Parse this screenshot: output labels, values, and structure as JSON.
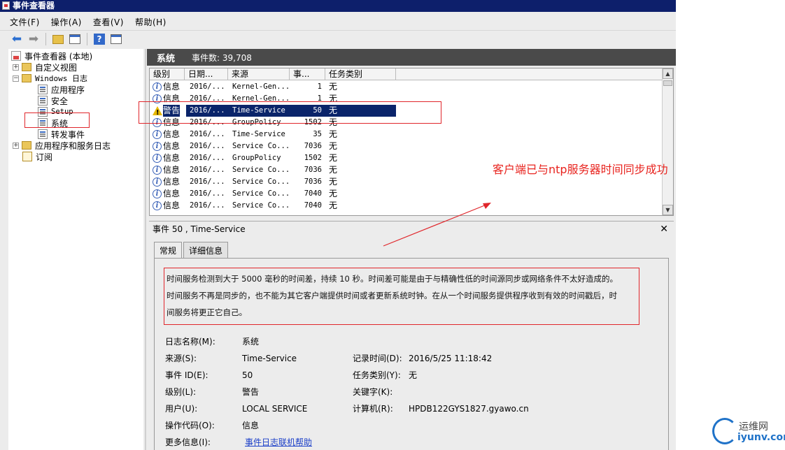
{
  "window": {
    "title": "事件查看器"
  },
  "menu": [
    "文件(F)",
    "操作(A)",
    "查看(V)",
    "帮助(H)"
  ],
  "tree": {
    "root": "事件查看器 (本地)",
    "custom_views": "自定义视图",
    "windows_logs": "Windows 日志",
    "app": "应用程序",
    "security": "安全",
    "setup": "Setup",
    "system": "系统",
    "forwarded": "转发事件",
    "app_service_logs": "应用程序和服务日志",
    "subscriptions": "订阅"
  },
  "panel": {
    "title": "系统",
    "count": "事件数: 39,708"
  },
  "grid": {
    "columns": [
      "级别",
      "日期...",
      "来源",
      "事...",
      "任务类别"
    ],
    "rows": [
      {
        "level": "信息",
        "type": "info",
        "date": "2016/...",
        "source": "Kernel-Gen...",
        "id": "1",
        "cat": "无"
      },
      {
        "level": "信息",
        "type": "info",
        "date": "2016/...",
        "source": "Kernel-Gen...",
        "id": "1",
        "cat": "无"
      },
      {
        "level": "警告",
        "type": "warn",
        "date": "2016/...",
        "source": "Time-Service",
        "id": "50",
        "cat": "无"
      },
      {
        "level": "信息",
        "type": "info",
        "date": "2016/...",
        "source": "GroupPolicy",
        "id": "1502",
        "cat": "无"
      },
      {
        "level": "信息",
        "type": "info",
        "date": "2016/...",
        "source": "Time-Service",
        "id": "35",
        "cat": "无"
      },
      {
        "level": "信息",
        "type": "info",
        "date": "2016/...",
        "source": "Service Co...",
        "id": "7036",
        "cat": "无"
      },
      {
        "level": "信息",
        "type": "info",
        "date": "2016/...",
        "source": "GroupPolicy",
        "id": "1502",
        "cat": "无"
      },
      {
        "level": "信息",
        "type": "info",
        "date": "2016/...",
        "source": "Service Co...",
        "id": "7036",
        "cat": "无"
      },
      {
        "level": "信息",
        "type": "info",
        "date": "2016/...",
        "source": "Service Co...",
        "id": "7036",
        "cat": "无"
      },
      {
        "level": "信息",
        "type": "info",
        "date": "2016/...",
        "source": "Service Co...",
        "id": "7040",
        "cat": "无"
      },
      {
        "level": "信息",
        "type": "info",
        "date": "2016/...",
        "source": "Service Co...",
        "id": "7040",
        "cat": "无"
      }
    ]
  },
  "detail": {
    "title": "事件 50 , Time-Service",
    "tab_general": "常规",
    "tab_details": "详细信息",
    "description_1": "时间服务检测到大于 5000 毫秒的时间差，持续 10 秒。时间差可能是由于与精确性低的时间源同步或网络条件不太好造成的。",
    "description_2": "时间服务不再是同步的，也不能为其它客户端提供时间或者更新系统时钟。在从一个时间服务提供程序收到有效的时间戳后，时",
    "description_3": "间服务将更正它自己。",
    "log_name_label": "日志名称(M):",
    "log_name": "系统",
    "source_label": "来源(S):",
    "source": "Time-Service",
    "recorded_label": "记录时间(D):",
    "recorded": "2016/5/25 11:18:42",
    "event_id_label": "事件 ID(E):",
    "event_id": "50",
    "task_label": "任务类别(Y):",
    "task": "无",
    "level_label": "级别(L):",
    "level": "警告",
    "keywords_label": "关键字(K):",
    "user_label": "用户(U):",
    "user": "LOCAL SERVICE",
    "computer_label": "计算机(R):",
    "computer": "HPDB122GYS1827.gyawo.cn",
    "opcode_label": "操作代码(O):",
    "opcode": "信息",
    "more_info_label": "更多信息(I):",
    "more_info_link": "事件日志联机帮助"
  },
  "annotation": {
    "note": "客户端已与ntp服务器时间同步成功"
  },
  "watermark": {
    "cn": "运维网",
    "en": "iyunv.com"
  },
  "colors": {
    "titlebar": "#0d1f6b",
    "selection": "#0a246a",
    "annotation_red": "#e0262b",
    "link": "#1a3ec8"
  }
}
